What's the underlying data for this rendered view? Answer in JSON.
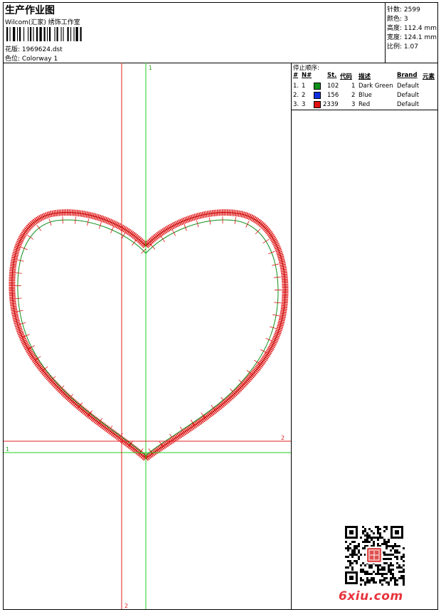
{
  "header": {
    "title": "生产作业图",
    "company": "Wilcom(汇家) 绣饰工作室",
    "design_label": "花版: 1969624.dst",
    "colorway_label": "色位: Colorway 1"
  },
  "stats": [
    "针数: 2599",
    "颜色: 3",
    "高度: 112.4 mm",
    "宽度: 124.1 mm",
    "比例: 1.07"
  ],
  "stop_sequence": {
    "title": "停止顺序:",
    "headers": [
      "#",
      "N#",
      "St.",
      "代码",
      "描述",
      "Brand",
      "元素"
    ],
    "rows": [
      {
        "num": "1.",
        "n": "1",
        "color": "#0f8f1a",
        "stitches": "102",
        "code": "1",
        "desc": "Dark Green",
        "brand": "Default"
      },
      {
        "num": "2.",
        "n": "2",
        "color": "#1030e0",
        "stitches": "156",
        "code": "2",
        "desc": "Blue",
        "brand": "Default"
      },
      {
        "num": "3.",
        "n": "3",
        "color": "#e01010",
        "stitches": "2339",
        "code": "3",
        "desc": "Red",
        "brand": "Default"
      }
    ]
  },
  "guides": {
    "green_v": "1",
    "green_h": "1",
    "red_v": "2",
    "red_h": "2"
  },
  "watermark": "6xiu.com",
  "colors": {
    "stitch_red": "#e01010",
    "underlay_green": "#0f8f1a",
    "guide_green": "#20d020",
    "guide_red": "#e02020"
  }
}
